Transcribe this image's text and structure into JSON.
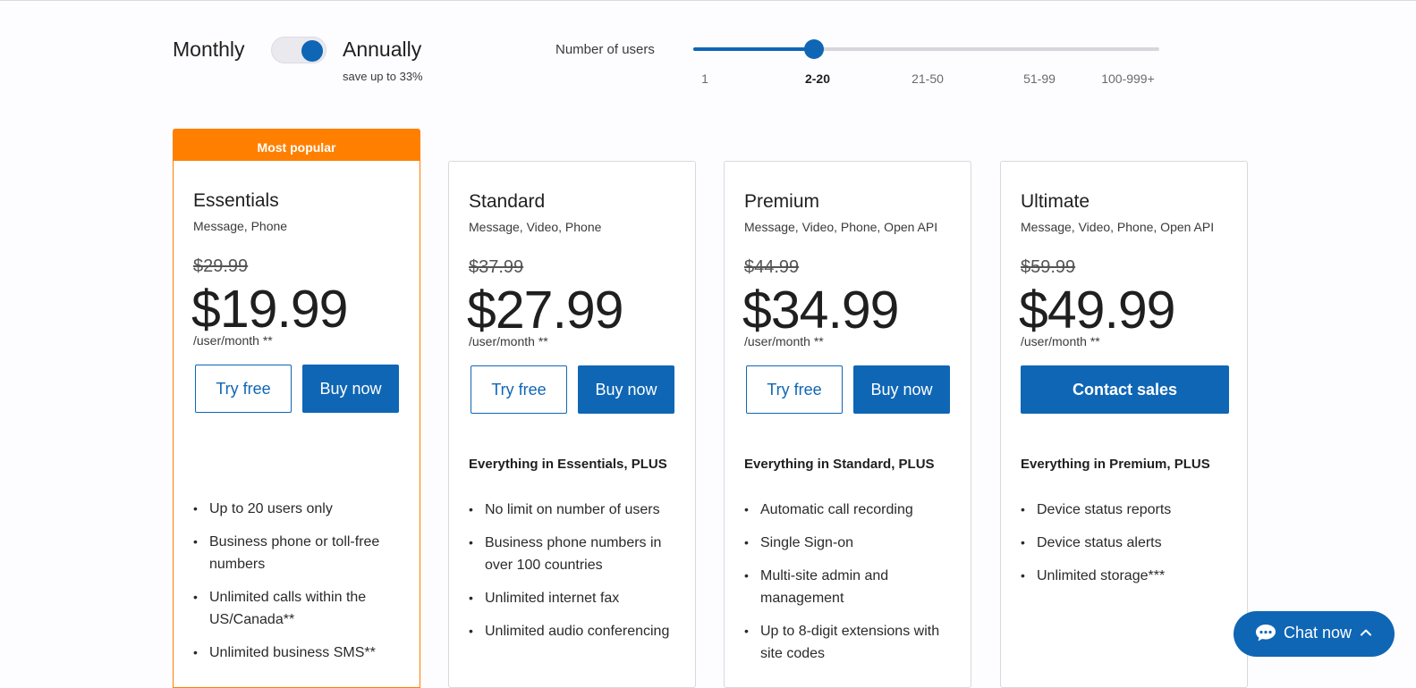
{
  "billing": {
    "monthly_label": "Monthly",
    "annually_label": "Annually",
    "save_note": "save up to 33%",
    "selected": "Annually"
  },
  "users_slider": {
    "label": "Number of users",
    "ticks": [
      "1",
      "2-20",
      "21-50",
      "51-99",
      "100-999+"
    ],
    "selected": "2-20",
    "selected_index": 1
  },
  "popular_badge": "Most popular",
  "plans": [
    {
      "name": "Essentials",
      "features": "Message, Phone",
      "old_price": "$29.99",
      "price": "$19.99",
      "per": "/user/month **",
      "try_label": "Try free",
      "buy_label": "Buy now",
      "plus_label": "",
      "bullets": [
        "Up to 20 users only",
        "Business phone or toll-free numbers",
        "Unlimited calls within the US/Canada**",
        "Unlimited business SMS**"
      ]
    },
    {
      "name": "Standard",
      "features": "Message, Video, Phone",
      "old_price": "$37.99",
      "price": "$27.99",
      "per": "/user/month **",
      "try_label": "Try free",
      "buy_label": "Buy now",
      "plus_label": "Everything in Essentials, PLUS",
      "bullets": [
        "No limit on number of users",
        "Business phone numbers in over 100 countries",
        "Unlimited internet fax",
        "Unlimited audio conferencing"
      ]
    },
    {
      "name": "Premium",
      "features": "Message, Video, Phone, Open API",
      "old_price": "$44.99",
      "price": "$34.99",
      "per": "/user/month **",
      "try_label": "Try free",
      "buy_label": "Buy now",
      "plus_label": "Everything in Standard, PLUS",
      "bullets": [
        "Automatic call recording",
        "Single Sign-on",
        "Multi-site admin and management",
        "Up to 8-digit extensions with site codes"
      ]
    },
    {
      "name": "Ultimate",
      "features": "Message, Video, Phone, Open API",
      "old_price": "$59.99",
      "price": "$49.99",
      "per": "/user/month **",
      "contact_label": "Contact sales",
      "plus_label": "Everything in Premium, PLUS",
      "bullets": [
        "Device status reports",
        "Device status alerts",
        "Unlimited storage***"
      ]
    }
  ],
  "chat": {
    "label": "Chat now"
  },
  "colors": {
    "accent": "#0f66b5",
    "popular": "#ff8000"
  }
}
